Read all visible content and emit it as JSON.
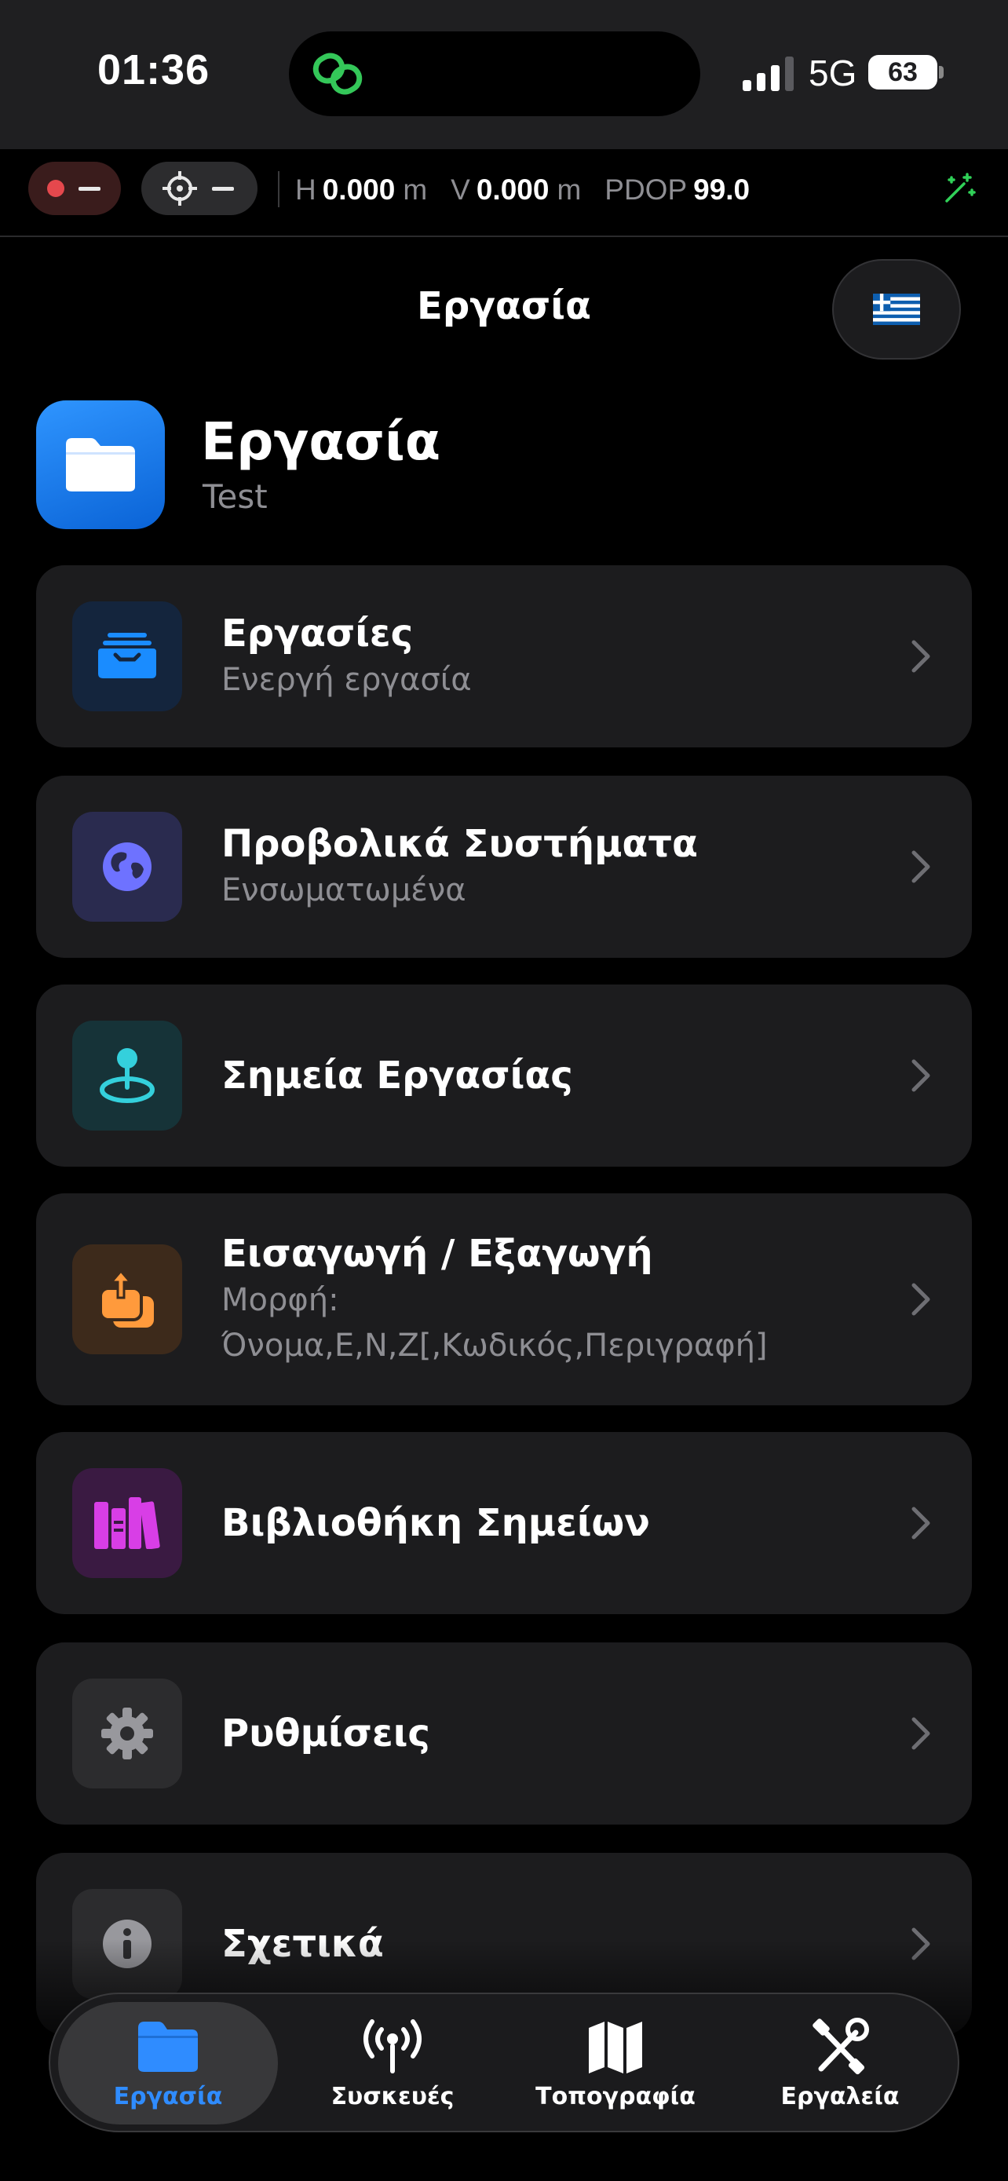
{
  "status_bar": {
    "time": "01:36",
    "network": "5G",
    "battery": "63"
  },
  "gnss_bar": {
    "h_label": "H",
    "h_value": "0.000",
    "h_unit": "m",
    "v_label": "V",
    "v_value": "0.000",
    "v_unit": "m",
    "pdop_label": "PDOP",
    "pdop_value": "99.0"
  },
  "header": {
    "title": "Εργασία",
    "language_flag": "🇬🇷"
  },
  "hero": {
    "title": "Εργασία",
    "subtitle": "Test"
  },
  "menu": [
    {
      "title": "Εργασίες",
      "subtitle": "Ενεργή εργασία",
      "icon": "tray-icon",
      "accent": "#1a8cff",
      "bg": "#14253d"
    },
    {
      "title": "Προβολικά Συστήματα",
      "subtitle": "Ενσωματωμένα",
      "icon": "globe-icon",
      "accent": "#6e72ff",
      "bg": "#2a2b4f"
    },
    {
      "title": "Σημεία Εργασίας",
      "subtitle": "",
      "icon": "map-pin-icon",
      "accent": "#34d0dc",
      "bg": "#163338"
    },
    {
      "title": "Εισαγωγή / Εξαγωγή",
      "subtitle": "Μορφή:",
      "subtitle2": "Όνομα,E,N,Z[,Κωδικός,Περιγραφή]",
      "icon": "import-export-icon",
      "accent": "#ff9a3c",
      "bg": "#3d2a1b"
    },
    {
      "title": "Βιβλιοθήκη Σημείων",
      "subtitle": "",
      "icon": "books-icon",
      "accent": "#d83ee6",
      "bg": "#3a1a42"
    },
    {
      "title": "Ρυθμίσεις",
      "subtitle": "",
      "icon": "gear-icon",
      "accent": "#98989d",
      "bg": "#2c2c2e"
    },
    {
      "title": "Σχετικά",
      "subtitle": "",
      "icon": "info-icon",
      "accent": "#98989d",
      "bg": "#2c2c2e"
    }
  ],
  "tabs": [
    {
      "label": "Εργασία",
      "icon": "folder-icon",
      "active": true
    },
    {
      "label": "Συσκευές",
      "icon": "antenna-icon",
      "active": false
    },
    {
      "label": "Τοπογραφία",
      "icon": "map-icon",
      "active": false
    },
    {
      "label": "Εργαλεία",
      "icon": "tools-icon",
      "active": false
    }
  ],
  "colors": {
    "accent_blue": "#2f8cff",
    "card_bg": "#1c1c1e",
    "record_red": "#e5484d",
    "secondary_text": "#8e8e93"
  }
}
